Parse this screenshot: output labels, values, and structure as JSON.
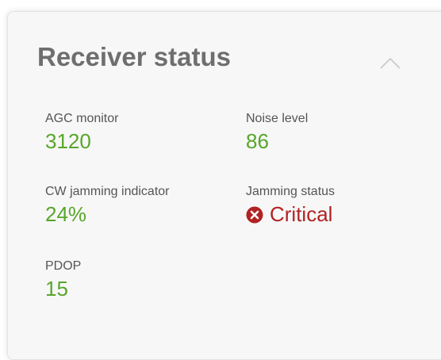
{
  "panel": {
    "title": "Receiver status",
    "collapse_icon": "chevron-up-icon"
  },
  "colors": {
    "ok": "#58a62a",
    "critical": "#b22222",
    "title": "#6e6e6e",
    "label": "#555555",
    "card_background": "#f7f7f7"
  },
  "fields": {
    "agc": {
      "label": "AGC monitor",
      "value": "3120"
    },
    "noise": {
      "label": "Noise level",
      "value": "86"
    },
    "cw": {
      "label": "CW jamming indicator",
      "value": "24%"
    },
    "jamming": {
      "label": "Jamming status",
      "value": "Critical",
      "icon": "x-circle-icon"
    },
    "pdop": {
      "label": "PDOP",
      "value": "15"
    }
  }
}
